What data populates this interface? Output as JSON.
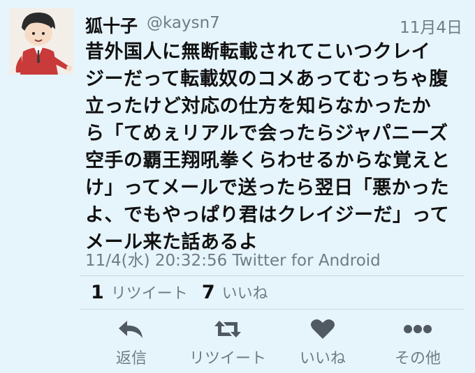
{
  "tweet": {
    "display_name": "狐十子",
    "handle": "@kaysn7",
    "date": "11月4日",
    "text": "昔外国人に無断転載されてこいつクレイ\nジーだって転載奴のコメあってむっちゃ腹\n立ったけど対応の仕方を知らなかったか\nら「てめぇリアルで会ったらジャパニーズ\n空手の覇王翔吼拳くらわせるからな覚えと\nけ」ってメールで送ったら翌日「悪かった\nよ、でもやっぱり君はクレイジーだ」って\nメール来た話あるよ",
    "timestamp": "11/4(水) 20:32:56 Twitter for Android"
  },
  "stats": {
    "retweet_count": "1",
    "retweet_label": "リツイート",
    "like_count": "7",
    "like_label": "いいね"
  },
  "actions": {
    "reply_label": "返信",
    "retweet_label": "リツイート",
    "like_label": "いいね",
    "more_label": "その他"
  },
  "colors": {
    "background": "#e6f4fb",
    "muted_text": "#6f7c85",
    "icon": "#505a62"
  }
}
